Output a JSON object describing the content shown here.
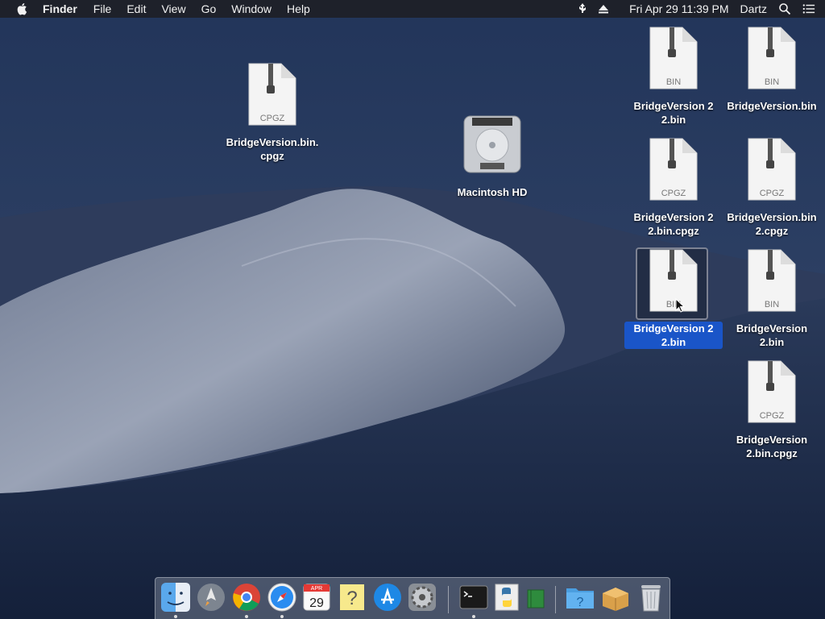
{
  "menubar": {
    "app_name": "Finder",
    "menus": [
      "File",
      "Edit",
      "View",
      "Go",
      "Window",
      "Help"
    ],
    "clock": "Fri Apr 29  11:39 PM",
    "user": "Dartz"
  },
  "desktop": {
    "icons": [
      {
        "label": "BridgeVersion.bin.cpgz",
        "badge": "CPGZ"
      },
      {
        "label": "Macintosh HD"
      },
      {
        "label": "BridgeVersion 2 2.bin",
        "badge": "BIN"
      },
      {
        "label": "BridgeVersion.bin",
        "badge": "BIN"
      },
      {
        "label": "BridgeVersion 2 2.bin.cpgz",
        "badge": "CPGZ"
      },
      {
        "label": "BridgeVersion.bin 2.cpgz",
        "badge": "CPGZ"
      },
      {
        "label": "BridgeVersion 2 2.bin",
        "badge": "BIN",
        "selected": true
      },
      {
        "label": "BridgeVersion 2.bin",
        "badge": "BIN"
      },
      {
        "label": "BridgeVersion 2.bin.cpgz",
        "badge": "CPGZ"
      }
    ]
  },
  "dock": {
    "calendar_day": "29",
    "calendar_month": "APR"
  },
  "colors": {
    "selection": "#1a55c8",
    "menubar": "#1e2026",
    "sky_top": "#24365a",
    "dune_light": "#8e97aa"
  }
}
